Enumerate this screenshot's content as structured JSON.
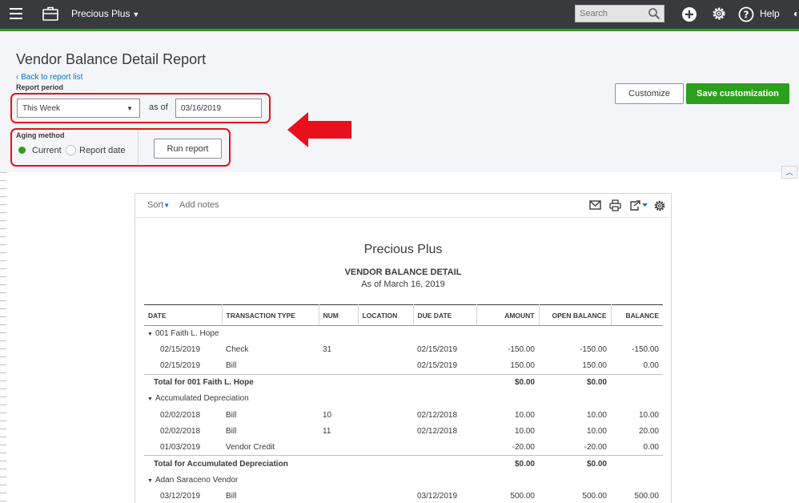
{
  "topbar": {
    "company_name": "Precious Plus",
    "search_placeholder": "Search",
    "help_label": "Help",
    "accent_color": "#2ca01c",
    "icons": [
      "hamburger-menu-icon",
      "briefcase-icon",
      "search-icon",
      "plus-circle-icon",
      "gear-icon",
      "help-circle-icon"
    ]
  },
  "header": {
    "title": "Vendor Balance Detail Report",
    "back_link": "Back to report list",
    "report_period_label": "Report period",
    "report_period_value": "This Week",
    "as_of_label": "as of",
    "as_of_date": "03/16/2019",
    "aging_method_label": "Aging method",
    "aging_current": "Current",
    "aging_report_date": "Report date",
    "run_report": "Run report",
    "customize": "Customize",
    "save_customization": "Save customization"
  },
  "toolbar": {
    "sort": "Sort",
    "add_notes": "Add notes",
    "icons": [
      "email-icon",
      "print-icon",
      "export-icon",
      "gear-icon"
    ]
  },
  "report": {
    "company": "Precious Plus",
    "title": "VENDOR BALANCE DETAIL",
    "date": "As of March 16, 2019",
    "columns": [
      "DATE",
      "TRANSACTION TYPE",
      "NUM",
      "LOCATION",
      "DUE DATE",
      "AMOUNT",
      "OPEN BALANCE",
      "BALANCE"
    ],
    "groups": [
      {
        "name": "001 Faith L. Hope",
        "rows": [
          [
            "02/15/2019",
            "Check",
            "31",
            "",
            "02/15/2019",
            "-150.00",
            "-150.00",
            "-150.00"
          ],
          [
            "02/15/2019",
            "Bill",
            "",
            "",
            "02/15/2019",
            "150.00",
            "150.00",
            "0.00"
          ]
        ],
        "total_label": "Total for 001 Faith L. Hope",
        "total_amount": "$0.00",
        "total_open": "$0.00"
      },
      {
        "name": "Accumulated Depreciation",
        "rows": [
          [
            "02/02/2018",
            "Bill",
            "10",
            "",
            "02/12/2018",
            "10.00",
            "10.00",
            "10.00"
          ],
          [
            "02/02/2018",
            "Bill",
            "11",
            "",
            "02/12/2018",
            "10.00",
            "10.00",
            "20.00"
          ],
          [
            "01/03/2019",
            "Vendor Credit",
            "",
            "",
            "",
            "-20.00",
            "-20.00",
            "0.00"
          ]
        ],
        "total_label": "Total for Accumulated Depreciation",
        "total_amount": "$0.00",
        "total_open": "$0.00"
      },
      {
        "name": "Adan Saraceno Vendor",
        "rows": [
          [
            "03/12/2019",
            "Bill",
            "",
            "",
            "03/12/2019",
            "500.00",
            "500.00",
            "500.00"
          ]
        ]
      }
    ]
  }
}
